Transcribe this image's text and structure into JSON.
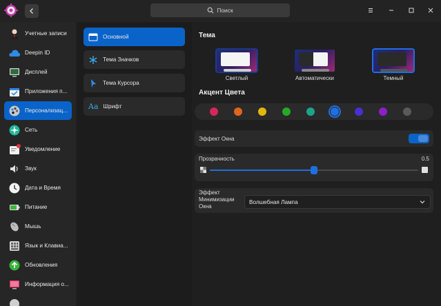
{
  "header": {
    "search_placeholder": "Поиск",
    "icons": [
      "app-gear-icon",
      "back-arrow-icon",
      "search-icon",
      "menu-icon",
      "minimize-icon",
      "maximize-icon",
      "close-icon"
    ]
  },
  "sidebar": {
    "items": [
      {
        "label": "Учетные записи",
        "icon": "accounts-icon"
      },
      {
        "label": "Deepin ID",
        "icon": "cloud-icon"
      },
      {
        "label": "Дисплей",
        "icon": "display-icon"
      },
      {
        "label": "Приложения п...",
        "icon": "default-apps-icon"
      },
      {
        "label": "Персонализац...",
        "icon": "personalization-icon",
        "active": true
      },
      {
        "label": "Сеть",
        "icon": "network-icon"
      },
      {
        "label": "Уведомление",
        "icon": "notification-icon"
      },
      {
        "label": "Звук",
        "icon": "sound-icon"
      },
      {
        "label": "Дата и Время",
        "icon": "clock-icon"
      },
      {
        "label": "Питание",
        "icon": "power-icon"
      },
      {
        "label": "Мышь",
        "icon": "mouse-icon"
      },
      {
        "label": "Язык и  Клавиа...",
        "icon": "keyboard-icon"
      },
      {
        "label": "Обновления",
        "icon": "update-icon"
      },
      {
        "label": "Информация о...",
        "icon": "info-icon"
      }
    ]
  },
  "subnav": {
    "items": [
      {
        "label": "Основной",
        "icon": "window-icon",
        "active": true
      },
      {
        "label": "Тема Значков",
        "icon": "snowflake-icon"
      },
      {
        "label": "Тема Курсора",
        "icon": "cursor-icon"
      },
      {
        "label": "Шрифт",
        "icon": "font-icon"
      }
    ]
  },
  "theme": {
    "title": "Тема",
    "options": [
      {
        "label": "Светлый"
      },
      {
        "label": "Автоматически"
      },
      {
        "label": "Темный",
        "selected": true
      }
    ]
  },
  "accent": {
    "title": "Акцент Цвета",
    "colors": [
      "#d7265a",
      "#e0661c",
      "#e0b90b",
      "#28a828",
      "#1aa58a",
      "#1f6fe0",
      "#4b2fd0",
      "#8b1fc8",
      "#5a5a5a"
    ],
    "selected_index": 5
  },
  "window_effect": {
    "label": "Эффект Окна",
    "enabled": true
  },
  "transparency": {
    "label": "Прозрачность",
    "value_text": "0.5",
    "value": 0.5
  },
  "minimize_effect": {
    "label_line1": "Эффект",
    "label_line2": "Минимизации",
    "label_line3": "Окна",
    "selected": "Волшебная Лампа"
  },
  "colors": {
    "accent": "#0a63c9",
    "background": "#1f1f1f"
  }
}
